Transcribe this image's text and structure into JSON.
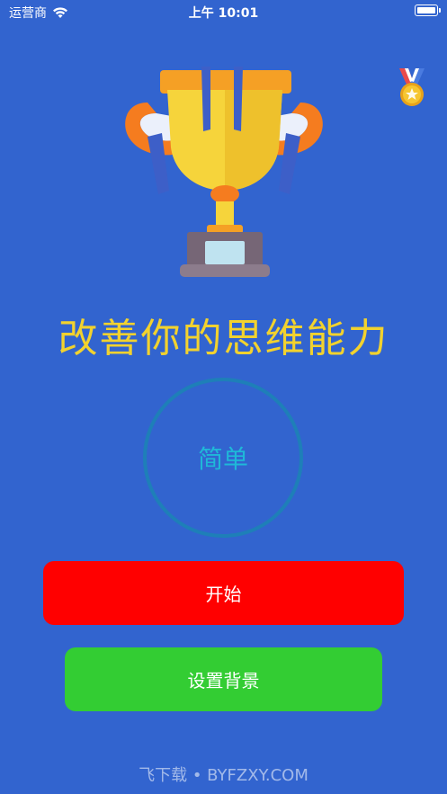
{
  "status_bar": {
    "carrier": "运营商",
    "time": "上午 10:01"
  },
  "icons": {
    "wifi": "wifi-icon",
    "battery": "battery-icon",
    "medal": "medal-icon",
    "trophy": "trophy-icon"
  },
  "main": {
    "title": "改善你的思维能力",
    "difficulty": "简单",
    "start_label": "开始",
    "set_background_label": "设置背景"
  },
  "watermark": "飞下载 • BYFZXY.COM",
  "colors": {
    "background": "#3264CF",
    "title": "#F2D22E",
    "difficulty_ring": "#1E7FB8",
    "difficulty_text": "#1FB8D8",
    "start_button": "#FF0000",
    "background_button": "#33CD33"
  }
}
